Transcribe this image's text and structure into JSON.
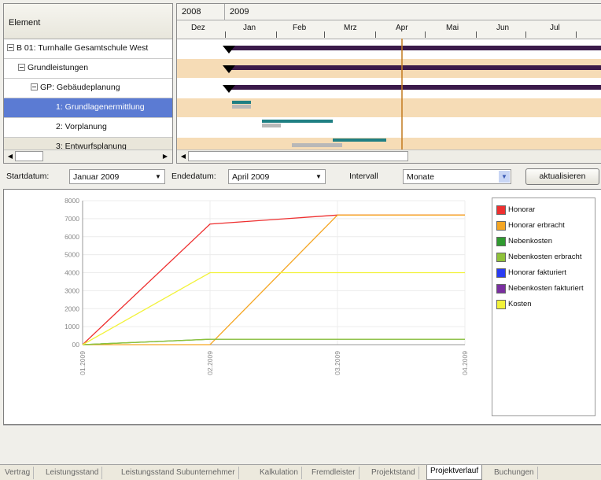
{
  "tree": {
    "header": "Element",
    "rows": [
      {
        "label": "B 01: Turnhalle Gesamtschule West"
      },
      {
        "label": "Grundleistungen"
      },
      {
        "label": "GP: Gebäudeplanung"
      },
      {
        "label": "1: Grundlagenermittlung"
      },
      {
        "label": "2: Vorplanung"
      },
      {
        "label": "3: Entwurfsplanung"
      }
    ]
  },
  "gantt": {
    "years": [
      "2008",
      "2009"
    ],
    "months": [
      "Dez",
      "Jan",
      "Feb",
      "Mrz",
      "Apr",
      "Mai",
      "Jun",
      "Jul"
    ],
    "colors": {
      "summary": "#3b1a4a",
      "plan": "#1f7f83",
      "actual": "#b8b8b8",
      "band": "#f6dcb6",
      "today": "#c27a1e"
    }
  },
  "controls": {
    "start_label": "Startdatum:",
    "start_value": "Januar 2009",
    "end_label": "Endedatum:",
    "end_value": "April 2009",
    "interval_label": "Intervall",
    "interval_value": "Monate",
    "refresh_label": "aktualisieren"
  },
  "chart_data": {
    "type": "line",
    "categories": [
      "01.2009",
      "02.2009",
      "03.2009",
      "04.2009"
    ],
    "y_ticks": [
      "8000",
      "7000",
      "6000",
      "5000",
      "4000",
      "3000",
      "2000",
      "1000",
      "00"
    ],
    "ylim": [
      0,
      8000
    ],
    "grid": true,
    "legend_position": "right",
    "series": [
      {
        "name": "Honorar",
        "color": "#ee2f2f",
        "values": [
          0,
          6700,
          7200,
          7200
        ]
      },
      {
        "name": "Honorar erbracht",
        "color": "#f5a623",
        "values": [
          0,
          0,
          7200,
          7200
        ]
      },
      {
        "name": "Nebenkosten",
        "color": "#2f9a2f",
        "values": [
          0,
          300,
          300,
          300
        ]
      },
      {
        "name": "Nebenkosten erbracht",
        "color": "#8fc23a",
        "values": [
          0,
          300,
          300,
          300
        ]
      },
      {
        "name": "Honorar fakturiert",
        "color": "#2a3cf2",
        "values": []
      },
      {
        "name": "Nebenkosten fakturiert",
        "color": "#7a2fa0",
        "values": []
      },
      {
        "name": "Kosten",
        "color": "#f2f23a",
        "values": [
          0,
          4000,
          4000,
          4000
        ]
      }
    ]
  },
  "tabs": [
    {
      "label": "Vertrag"
    },
    {
      "label": "Leistungsstand"
    },
    {
      "label": "Leistungsstand Subunternehmer"
    },
    {
      "label": "Kalkulation"
    },
    {
      "label": "Fremdleister"
    },
    {
      "label": "Projektstand"
    },
    {
      "label": "Projektverlauf",
      "active": true
    },
    {
      "label": "Buchungen"
    }
  ]
}
